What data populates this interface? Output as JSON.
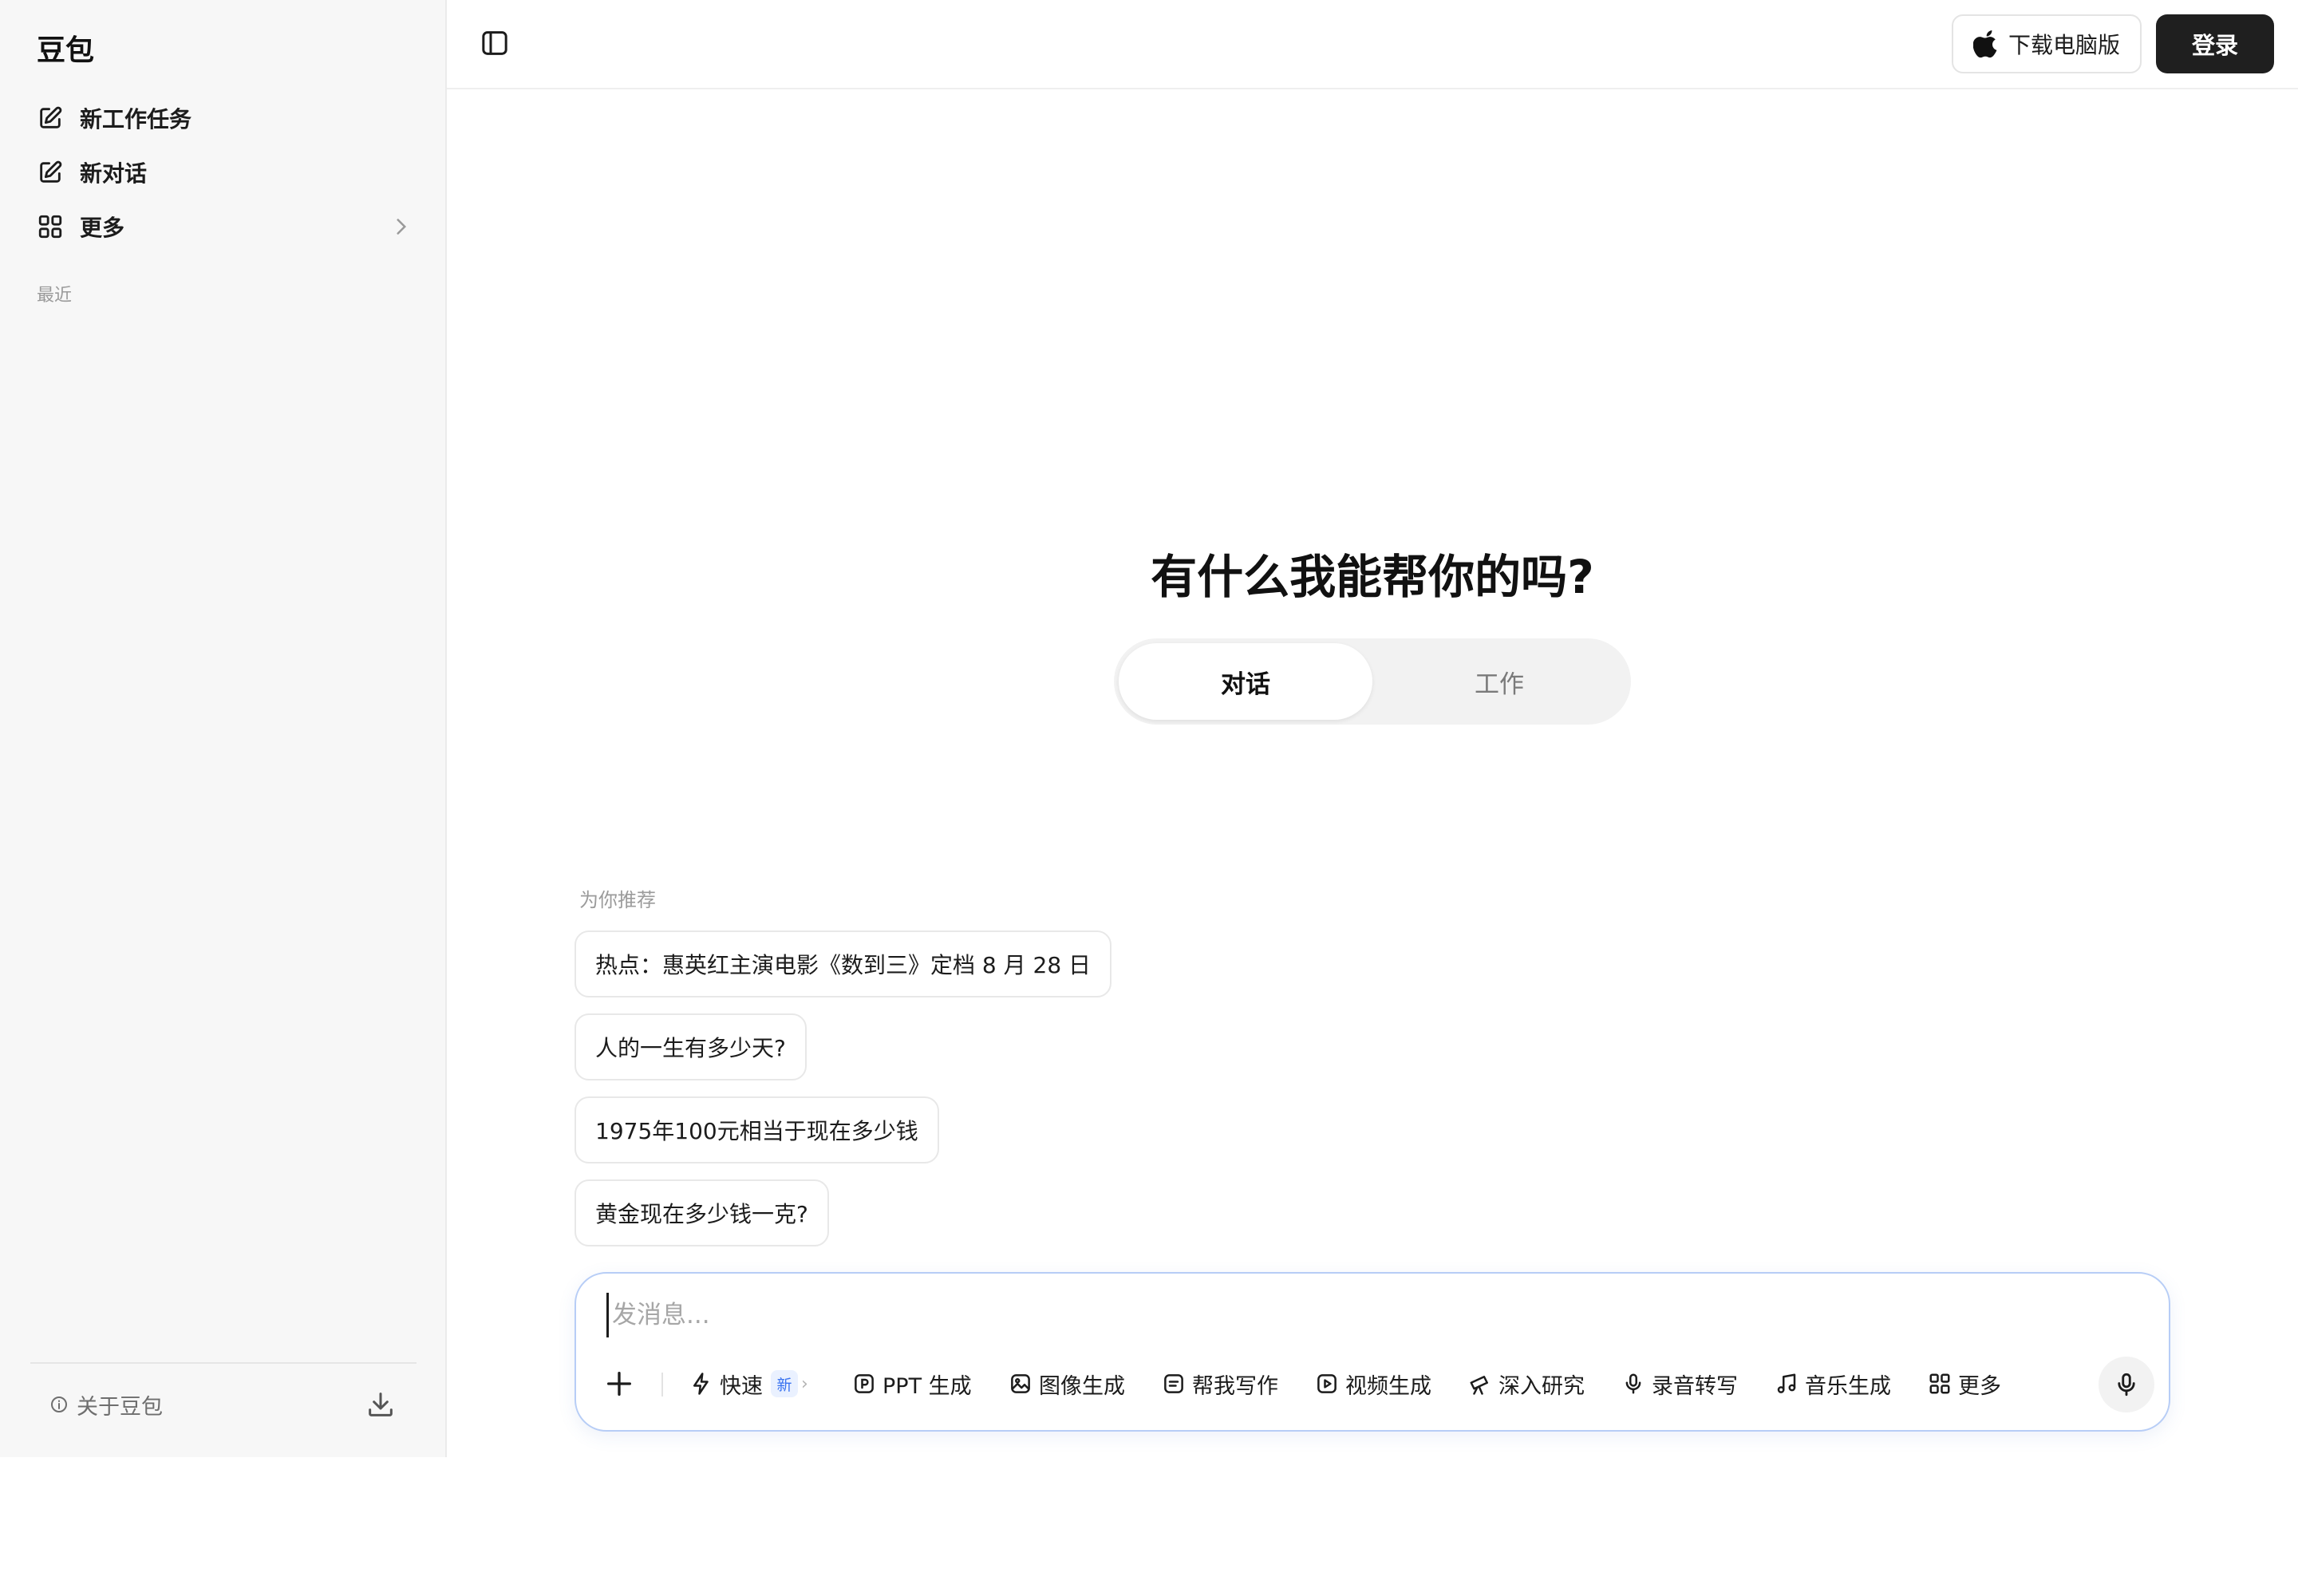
{
  "sidebar": {
    "brand": "豆包",
    "items": [
      {
        "label": "新工作任务",
        "icon": "edit-icon"
      },
      {
        "label": "新对话",
        "icon": "edit-icon"
      },
      {
        "label": "更多",
        "icon": "grid-icon"
      }
    ],
    "recent_label": "最近",
    "about_label": "关于豆包"
  },
  "topbar": {
    "download_label": "下载电脑版",
    "login_label": "登录"
  },
  "main": {
    "title": "有什么我能帮你的吗?",
    "tabs": [
      {
        "label": "对话",
        "active": true
      },
      {
        "label": "工作",
        "active": false
      }
    ],
    "recommend_label": "为你推荐",
    "recommendations": [
      "热点：惠英红主演电影《数到三》定档 8 月 28 日",
      "人的一生有多少天?",
      "1975年100元相当于现在多少钱",
      "黄金现在多少钱一克?"
    ]
  },
  "composer": {
    "placeholder": "发消息...",
    "tools": [
      {
        "label": "快速",
        "icon": "lightning-icon",
        "badge": "新"
      },
      {
        "label": "PPT 生成",
        "icon": "ppt-icon"
      },
      {
        "label": "图像生成",
        "icon": "image-icon"
      },
      {
        "label": "帮我写作",
        "icon": "write-icon"
      },
      {
        "label": "视频生成",
        "icon": "video-icon"
      },
      {
        "label": "深入研究",
        "icon": "telescope-icon"
      },
      {
        "label": "录音转写",
        "icon": "mic-icon"
      },
      {
        "label": "音乐生成",
        "icon": "music-icon"
      },
      {
        "label": "更多",
        "icon": "grid-icon"
      }
    ]
  },
  "colors": {
    "accent_border": "#b7cdf6",
    "login_bg": "#1f1f1f",
    "badge_blue": "#3a73f0"
  }
}
